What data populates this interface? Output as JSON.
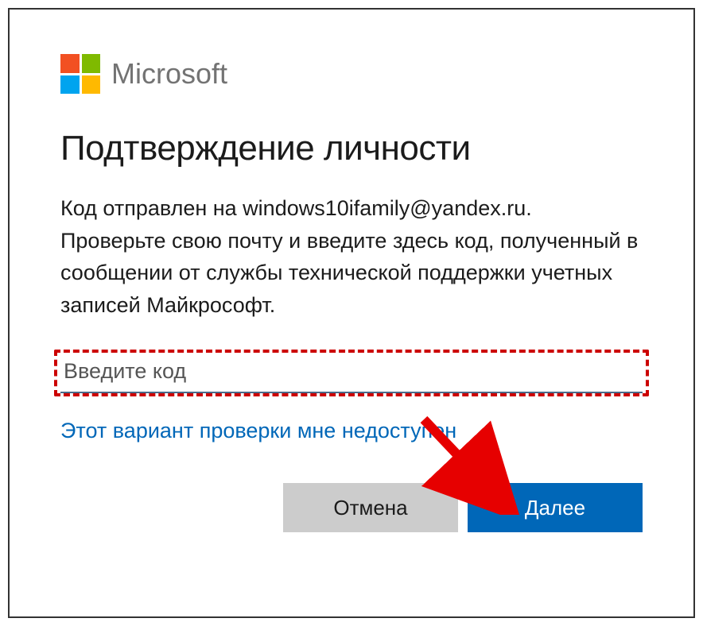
{
  "brand": "Microsoft",
  "heading": "Подтверждение личности",
  "description": "Код отправлен на windows10ifamily@yandex.ru. Проверьте свою почту и введите здесь код, полученный в сообщении от службы технической поддержки учетных записей Майкрософт.",
  "code_input": {
    "placeholder": "Введите код",
    "value": ""
  },
  "alt_link": "Этот вариант проверки мне недоступен",
  "buttons": {
    "cancel": "Отмена",
    "next": "Далее"
  },
  "colors": {
    "primary": "#0067b8",
    "highlight": "#cc0000",
    "cancel_bg": "#cccccc"
  }
}
